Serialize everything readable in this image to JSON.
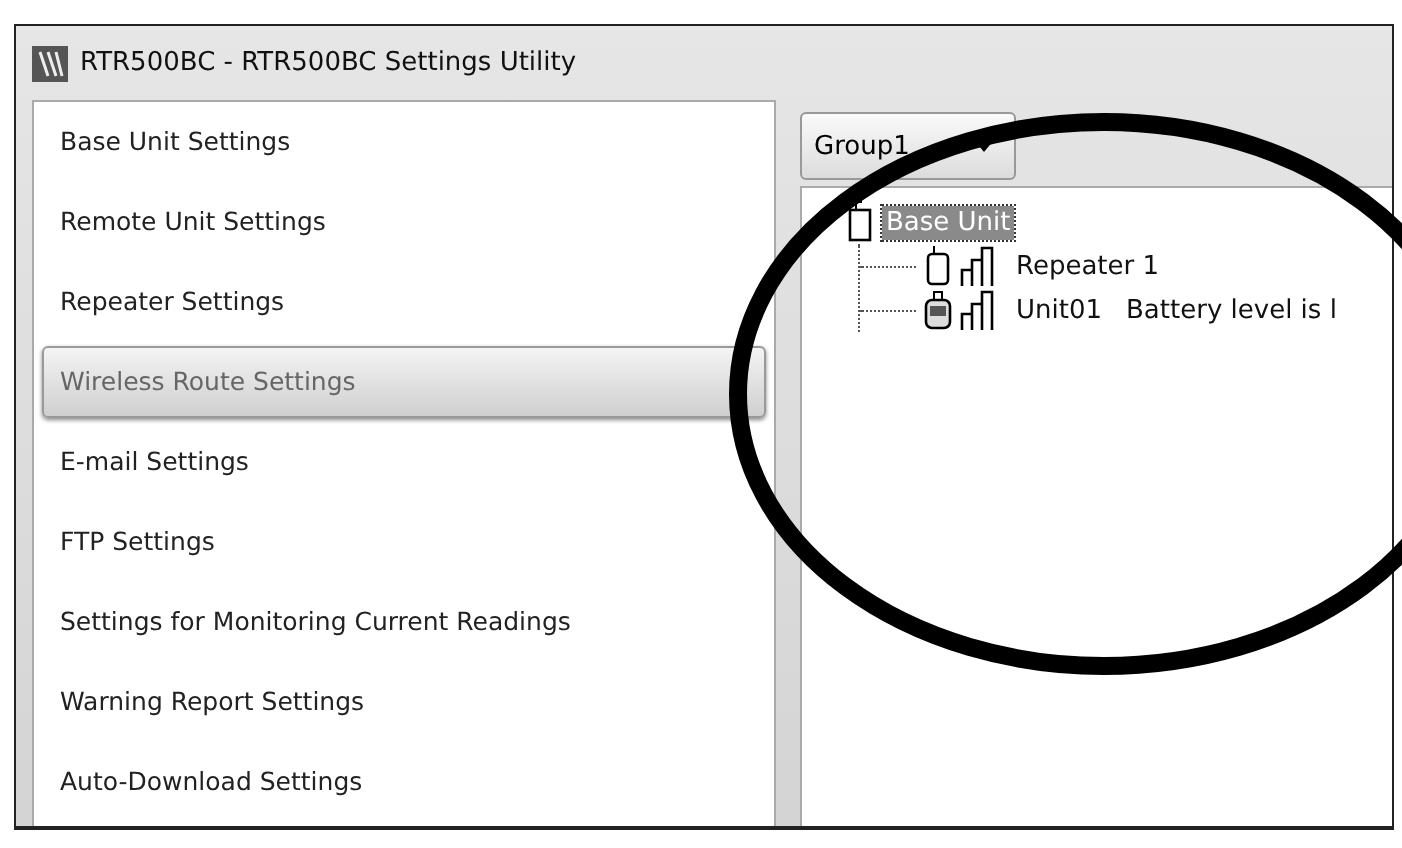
{
  "window": {
    "title": "RTR500BC - RTR500BC Settings Utility"
  },
  "sidebar": {
    "items": [
      {
        "label": "Base Unit Settings",
        "selected": false
      },
      {
        "label": "Remote Unit Settings",
        "selected": false
      },
      {
        "label": "Repeater Settings",
        "selected": false
      },
      {
        "label": "Wireless Route Settings",
        "selected": true
      },
      {
        "label": "E-mail Settings",
        "selected": false
      },
      {
        "label": "FTP Settings",
        "selected": false
      },
      {
        "label": "Settings for Monitoring Current Readings",
        "selected": false
      },
      {
        "label": "Warning Report Settings",
        "selected": false
      },
      {
        "label": "Auto-Download Settings",
        "selected": false
      }
    ]
  },
  "group_dropdown": {
    "value": "Group1"
  },
  "tree": {
    "items": [
      {
        "kind": "base",
        "label": "Base Unit",
        "selected": true,
        "children": [
          {
            "kind": "repeater",
            "label": "Repeater 1",
            "selected": false
          },
          {
            "kind": "unit",
            "label": "Unit01",
            "status": "Battery level is l",
            "selected": false
          }
        ]
      }
    ]
  }
}
